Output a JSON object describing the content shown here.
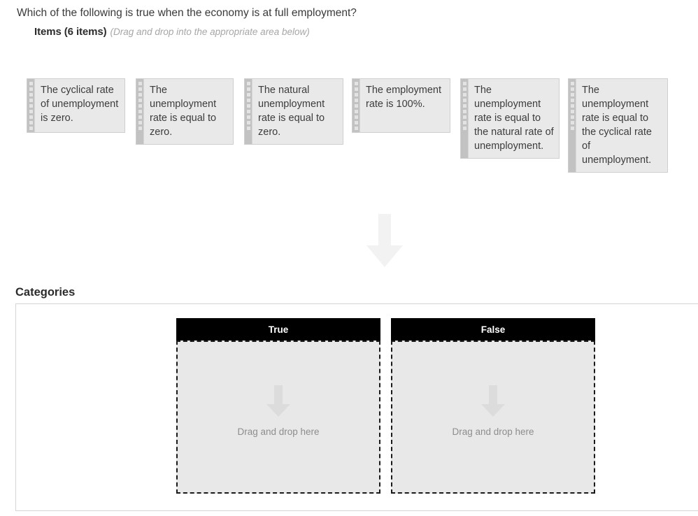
{
  "question": {
    "title": "Which of the following is true when the economy is at full employment?",
    "items_label": "Items (6 items)",
    "items_hint": "(Drag and drop into the appropriate area below)"
  },
  "items": [
    {
      "text": "The cyclical rate of unemployment is zero."
    },
    {
      "text": "The unemployment rate is equal to zero."
    },
    {
      "text": "The natural unemployment rate is equal to zero."
    },
    {
      "text": "The employment rate is 100%."
    },
    {
      "text": "The unemployment rate is equal to the natural rate of unemployment."
    },
    {
      "text": "The unemployment rate is equal to the cyclical rate of unemployment."
    }
  ],
  "categories": {
    "title": "Categories",
    "columns": [
      {
        "label": "True",
        "dropzone_text": "Drag and drop here"
      },
      {
        "label": "False",
        "dropzone_text": "Drag and drop here"
      }
    ]
  },
  "icons": {
    "flow_arrow": "arrow-down-icon",
    "dropzone_arrow": "arrow-down-icon",
    "drag_handle": "drag-handle-icon"
  },
  "colors": {
    "page_background": "#ffffff",
    "card_background": "#e9e9e9",
    "card_border": "#cfcfcf",
    "handle": "#c2c2c2",
    "header_black": "#000000",
    "dropzone_background": "#e8e8e8",
    "dropzone_border": "#1a1a1a",
    "flow_arrow": "#f2f2f2",
    "dropzone_arrow": "#dcdcdc",
    "text": "#3a3a3a",
    "hint_text": "#a6a6a6",
    "placeholder_text": "#8d8d8d"
  }
}
